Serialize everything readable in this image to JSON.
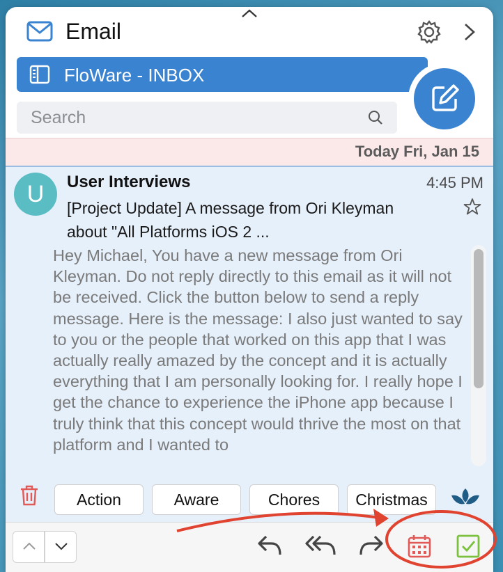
{
  "header": {
    "title": "Email",
    "icons": [
      "mail-icon",
      "gear-icon",
      "chevron-right-icon",
      "chevron-up-icon"
    ]
  },
  "inbox": {
    "label": "FloWare - INBOX"
  },
  "search": {
    "placeholder": "Search"
  },
  "date_header": {
    "label": "Today Fri, Jan 15"
  },
  "email": {
    "avatar_letter": "U",
    "sender": "User Interviews",
    "time": "4:45 PM",
    "subject": "[Project Update] A message from Ori Kleyman about \"All Platforms iOS 2 ...",
    "preview": "Hey Michael, You have a new message from Ori Kleyman. Do not reply directly to this email as it will not be received. Click the button below to send a reply message. Here is the message: I also just wanted to say to you or the people that worked on this app that I was actually really amazed by the concept and it is actually everything that I am personally looking for. I really hope I get the chance to experience the iPhone app because I truly think that this concept would thrive the most on that platform and I wanted to"
  },
  "tags": [
    "Action",
    "Aware",
    "Chores",
    "Christmas"
  ],
  "toolbar": {
    "icons": [
      "chevron-up-icon",
      "chevron-down-icon",
      "reply-icon",
      "reply-all-icon",
      "forward-icon",
      "calendar-icon",
      "checkbox-icon"
    ]
  },
  "colors": {
    "accent": "#3a83d1",
    "avatar": "#5bbdc4",
    "date_bar": "#fbe9ea",
    "email_panel": "#e6f0fb",
    "trash": "#e25a57",
    "calendar": "#e25a57",
    "check": "#7cc13e",
    "annotation": "#e0432f"
  }
}
